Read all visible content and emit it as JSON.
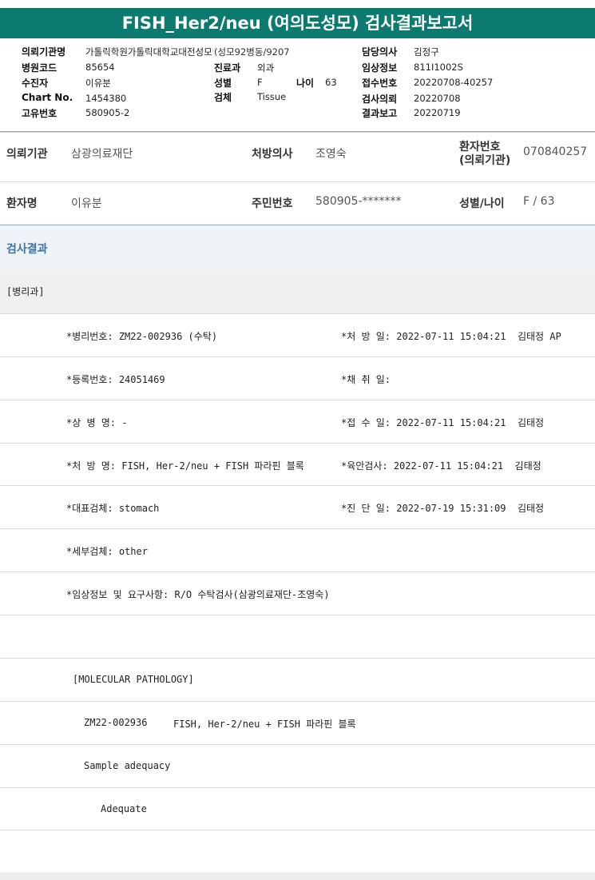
{
  "title": "FISH_Her2/neu (여의도성모) 검사결과보고서",
  "header": {
    "col1": [
      {
        "label": "의뢰기관명",
        "value": "가톨릭학원가톨릭대학교대전성모병원(성모92병동/9207"
      },
      {
        "label": "병원코드",
        "value": "85654"
      },
      {
        "label": "수진자",
        "value": "이유분"
      },
      {
        "label": "Chart No.",
        "value": "1454380"
      },
      {
        "label": "고유번호",
        "value": "580905-2"
      }
    ],
    "col2": [
      {
        "label": "진료과",
        "value": "외과"
      },
      {
        "label": "성별",
        "value": "F"
      },
      {
        "label": "검체",
        "value": "Tissue"
      }
    ],
    "age_label": "나이",
    "age_value": "63",
    "col3": [
      {
        "label": "담당의사",
        "value": "김정구"
      },
      {
        "label": "임상정보",
        "value": "811I1002S"
      },
      {
        "label": "접수번호",
        "value": "20220708-40257"
      },
      {
        "label": "검사의뢰",
        "value": "20220708"
      },
      {
        "label": "결과보고",
        "value": "20220719"
      }
    ]
  },
  "request": {
    "institution_label": "의뢰기관",
    "institution_value": "삼광의료재단",
    "doctor_label": "처방의사",
    "doctor_value": "조영숙",
    "patno_label_1": "환자번호",
    "patno_label_2": "(의뢰기관)",
    "patno_value": "070840257",
    "name_label": "환자명",
    "name_value": "이유분",
    "rrn_label": "주민번호",
    "rrn_value": "580905-*******",
    "sexage_label": "성별/나이",
    "sexage_value": "F / 63"
  },
  "results": {
    "section_title": "검사결과",
    "department": "[병리과]",
    "rows": [
      {
        "left": "*병리번호: ZM22-002936 (수탁)",
        "right": "*처 방 일: 2022-07-11 15:04:21  김태정 AP"
      },
      {
        "left": "*등록번호: 24051469",
        "right": "*채 취 일:"
      },
      {
        "left": "*상 병 명: -",
        "right": "*접 수 일: 2022-07-11 15:04:21  김태정"
      },
      {
        "left": "*처 방 명: FISH, Her-2/neu + FISH 파라핀 블록",
        "right": "*육안검사: 2022-07-11 15:04:21  김태정"
      },
      {
        "left": "*대표검체: stomach",
        "right": "*진 단 일: 2022-07-19 15:31:09  김태정"
      },
      {
        "left": "*세부검체: other",
        "right": ""
      },
      {
        "left": "*임상정보 및 요구사항: R/O 수탁검사(삼광의료재단-조영숙)",
        "right": ""
      }
    ],
    "molecular_title": "[MOLECULAR PATHOLOGY]",
    "case_no": "ZM22-002936",
    "case_test": "FISH, Her-2/neu + FISH 파라핀 블록",
    "adequacy_label": "Sample adequacy",
    "adequacy_value": "Adequate"
  }
}
